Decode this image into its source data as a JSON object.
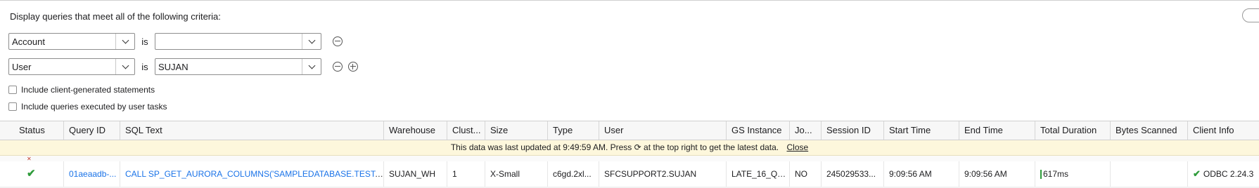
{
  "filter": {
    "title": "Display queries that meet all of the following criteria:",
    "conditions": [
      {
        "field": "Account",
        "operator": "is",
        "value": ""
      },
      {
        "field": "User",
        "operator": "is",
        "value": "SUJAN"
      }
    ],
    "checkboxes": [
      {
        "label": "Include client-generated statements",
        "checked": false
      },
      {
        "label": "Include queries executed by user tasks",
        "checked": false
      }
    ]
  },
  "table": {
    "columns": [
      "Status",
      "Query ID",
      "SQL Text",
      "Warehouse",
      "Clust...",
      "Size",
      "Type",
      "User",
      "GS Instance",
      "Jo...",
      "Session ID",
      "Start Time",
      "End Time",
      "Total Duration",
      "Bytes Scanned",
      "Client Info"
    ],
    "banner": {
      "message": "This data was last updated at 9:49:59 AM. Press ⟳ at the top right to get the latest data.",
      "close_label": "Close"
    },
    "rows": [
      {
        "status_icon": "success-check-icon",
        "query_id": "01aeaadb-...",
        "sql_text": "CALL SP_GET_AURORA_COLUMNS('SAMPLEDATABASE.TEST.MYCS...",
        "warehouse": "SUJAN_WH",
        "clusters": "1",
        "size": "X-Small",
        "type": "c6gd.2xl...",
        "user": "SFCSUPPORT2.SUJAN",
        "gs_instance": "LATE_16_QU...",
        "jobs": "NO",
        "session_id": "245029533...",
        "start_time": "9:09:56 AM",
        "end_time": "9:09:56 AM",
        "total_duration": "617ms",
        "bytes_scanned": "",
        "client_info": "ODBC 2.24.3"
      }
    ]
  },
  "colors": {
    "link": "#1a73e8",
    "success": "#2e9b3a",
    "banner_bg": "#fdf7dc"
  }
}
